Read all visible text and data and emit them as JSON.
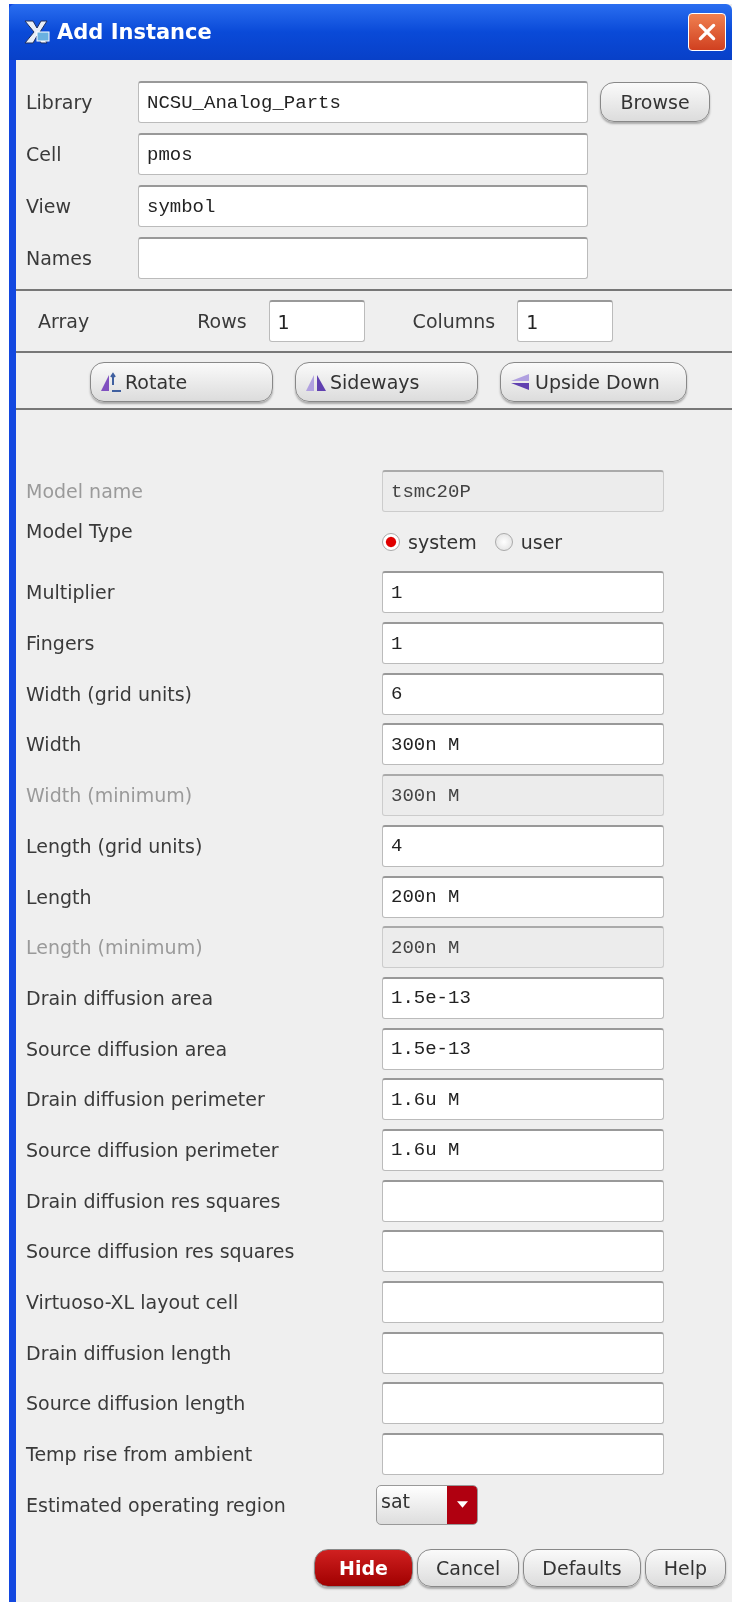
{
  "window": {
    "title": "Add Instance"
  },
  "cell_fields": [
    {
      "label": "Library",
      "value": "NCSU_Analog_Parts"
    },
    {
      "label": "Cell",
      "value": "pmos"
    },
    {
      "label": "View",
      "value": "symbol"
    },
    {
      "label": "Names"
    }
  ],
  "browse_button": "Browse",
  "array": {
    "label": "Array",
    "rows_label": "Rows",
    "rows": "1",
    "columns_label": "Columns",
    "columns": "1"
  },
  "transform_buttons": [
    {
      "kind": "rotate",
      "label": "Rotate"
    },
    {
      "kind": "sideways",
      "label": "Sideways"
    },
    {
      "kind": "upside_down",
      "label": "Upside Down"
    }
  ],
  "parameters": [
    {
      "kind": "field",
      "label": "Model name",
      "value": "tsmc20P",
      "disabled": true
    },
    {
      "kind": "radio",
      "label": "Model Type",
      "options": [
        {
          "label": "system",
          "selected": true
        },
        {
          "label": "user",
          "selected": false
        }
      ]
    },
    {
      "kind": "field",
      "label": "Multiplier",
      "value": "1",
      "disabled": false
    },
    {
      "kind": "field",
      "label": "Fingers",
      "value": "1",
      "disabled": false
    },
    {
      "kind": "field",
      "label": "Width (grid units)",
      "value": "6",
      "disabled": false
    },
    {
      "kind": "field",
      "label": "Width",
      "value": "300n M",
      "disabled": false
    },
    {
      "kind": "field",
      "label": "Width (minimum)",
      "value": "300n M",
      "disabled": true
    },
    {
      "kind": "field",
      "label": "Length (grid units)",
      "value": "4",
      "disabled": false
    },
    {
      "kind": "field",
      "label": "Length",
      "value": "200n M",
      "disabled": false
    },
    {
      "kind": "field",
      "label": "Length (minimum)",
      "value": "200n M",
      "disabled": true
    },
    {
      "kind": "field",
      "label": "Drain diffusion area",
      "value": "1.5e-13",
      "disabled": false
    },
    {
      "kind": "field",
      "label": "Source diffusion area",
      "value": "1.5e-13",
      "disabled": false
    },
    {
      "kind": "field",
      "label": "Drain diffusion perimeter",
      "value": "1.6u M",
      "disabled": false
    },
    {
      "kind": "field",
      "label": "Source diffusion perimeter",
      "value": "1.6u M",
      "disabled": false
    },
    {
      "kind": "field",
      "label": "Drain diffusion res squares",
      "disabled": false
    },
    {
      "kind": "field",
      "label": "Source diffusion res squares",
      "disabled": false
    },
    {
      "kind": "field",
      "label": "Virtuoso-XL layout cell",
      "disabled": false
    },
    {
      "kind": "field",
      "label": "Drain diffusion length",
      "disabled": false
    },
    {
      "kind": "field",
      "label": "Source diffusion length",
      "disabled": false
    },
    {
      "kind": "field",
      "label": "Temp rise from ambient",
      "disabled": false
    },
    {
      "kind": "dropdown",
      "label": "Estimated operating region",
      "value": "sat"
    }
  ],
  "footer_buttons": [
    {
      "label": "Hide",
      "default": true
    },
    {
      "label": "Cancel",
      "default": false
    },
    {
      "label": "Defaults",
      "default": false
    },
    {
      "label": "Help",
      "default": false
    }
  ]
}
